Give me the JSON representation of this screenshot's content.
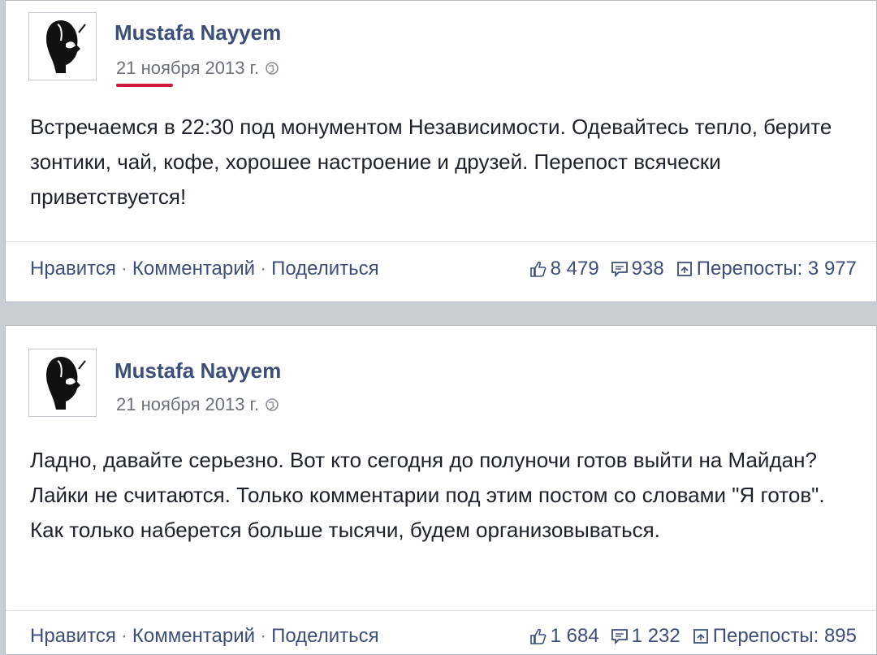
{
  "posts": [
    {
      "author": "Mustafa Nayyem",
      "date": "21 ноября 2013 г.",
      "text": "Встречаемся в 22:30 под монументом Независимости. Одевайтесь тепло, берите зонтики, чай, кофе, хорошее настроение и друзей. Перепост всячески приветствуется!",
      "actions": {
        "like": "Нравится",
        "comment": "Комментарий",
        "share": "Поделиться",
        "separator": "·"
      },
      "stats": {
        "likes": "8 479",
        "comments": "938",
        "reposts": "Перепосты: 3 977"
      }
    },
    {
      "author": "Mustafa Nayyem",
      "date": "21 ноября 2013 г.",
      "text": "Ладно, давайте серьезно. Вот кто сегодня до полуночи готов выйти на Майдан? Лайки не считаются. Только комментарии под этим постом со словами \"Я готов\". Как только наберется больше тысячи, будем организовываться.",
      "actions": {
        "like": "Нравится",
        "comment": "Комментарий",
        "share": "Поделиться",
        "separator": "·"
      },
      "stats": {
        "likes": "1 684",
        "comments": "1 232",
        "reposts": "Перепосты: 895"
      }
    }
  ],
  "colors": {
    "link": "#3b4f7a",
    "highlight": "#d0193a",
    "text": "#1d2129",
    "meta": "#6b7079"
  },
  "icons": [
    "avatar-portrait-icon",
    "globe-icon",
    "thumbs-up-icon",
    "comment-icon",
    "repost-icon"
  ]
}
